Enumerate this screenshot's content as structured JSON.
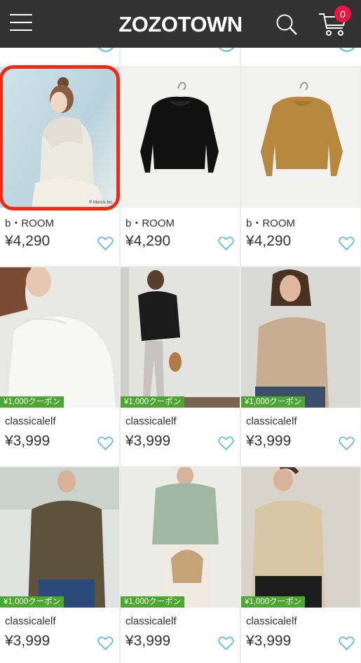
{
  "header": {
    "logo": "ZOZOTOWN",
    "cart_count": "0",
    "menu_icon": "hamburger-menu-icon",
    "search_icon": "search-icon",
    "cart_icon": "cart-icon"
  },
  "colors": {
    "header_bg": "#323232",
    "badge": "#e8173b",
    "coupon": "#4aa82e",
    "favorite": "#5fb8ec",
    "highlight": "#f12a12"
  },
  "products": [
    {
      "brand": "b・ROOM",
      "price": "¥4,290",
      "coupon": "",
      "copyright": "© Mercis Inc."
    },
    {
      "brand": "b・ROOM",
      "price": "¥4,290",
      "coupon": ""
    },
    {
      "brand": "b・ROOM",
      "price": "¥4,290",
      "coupon": ""
    },
    {
      "brand": "classicalelf",
      "price": "¥3,999",
      "coupon": "¥1,000クーポン"
    },
    {
      "brand": "classicalelf",
      "price": "¥3,999",
      "coupon": "¥1,000クーポン"
    },
    {
      "brand": "classicalelf",
      "price": "¥3,999",
      "coupon": "¥1,000クーポン"
    },
    {
      "brand": "classicalelf",
      "price": "¥3,999",
      "coupon": "¥1,000クーポン"
    },
    {
      "brand": "classicalelf",
      "price": "¥3,999",
      "coupon": "¥1,000クーポン"
    },
    {
      "brand": "classicalelf",
      "price": "¥3,999",
      "coupon": "¥1,000クーポン"
    }
  ]
}
